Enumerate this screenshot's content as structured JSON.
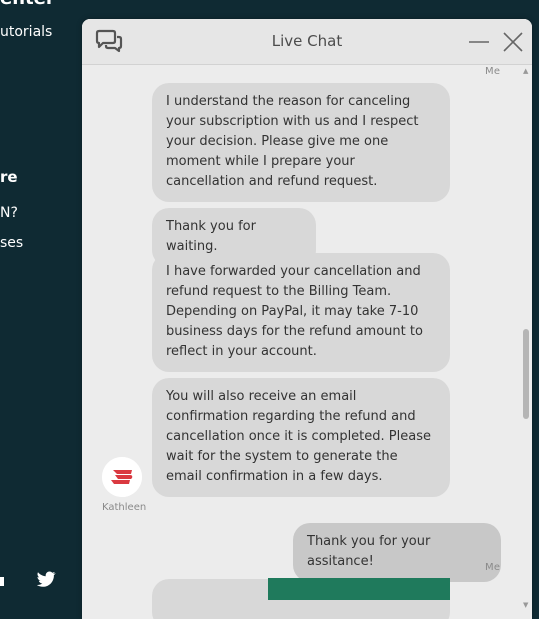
{
  "background": {
    "title_fragment": "enter",
    "nav_item_tutorials": "utorials",
    "section_heading": "re",
    "item_vpn": "N?",
    "item_uses": "ses"
  },
  "chat": {
    "title": "Live Chat",
    "messages": [
      {
        "from": "agent",
        "text": "I understand the reason for canceling your subscription with us and I respect your decision. Please give me one moment while I prepare your cancellation and refund request."
      },
      {
        "from": "agent",
        "text": "Thank you for waiting."
      },
      {
        "from": "agent",
        "text": "I have forwarded your cancellation and refund request to the Billing Team. Depending on PayPal, it may take 7-10 business days for the refund amount to reflect in your account."
      },
      {
        "from": "agent",
        "text": "You will also receive an email confirmation regarding the refund and cancellation once it is completed. Please wait for the system to generate the email confirmation in a few days."
      },
      {
        "from": "me",
        "text": "Thank you for your assitance!"
      }
    ],
    "me_label": "Me",
    "agent_name": "Kathleen",
    "colors": {
      "header_bg": "#e6e6e6",
      "body_bg": "#ececec",
      "bubble_bg": "#d8d8d8",
      "brand_red": "#da3940",
      "page_bg": "#0f2a33",
      "input_bar": "#1f7a5c"
    },
    "icons": [
      "chat-bubbles-icon",
      "minimize-icon",
      "close-icon",
      "twitter-icon"
    ]
  }
}
